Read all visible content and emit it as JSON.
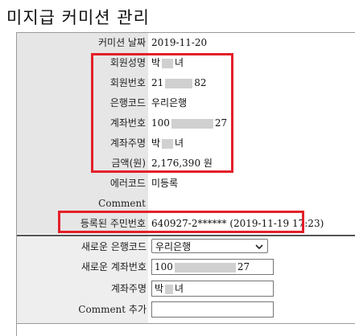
{
  "page": {
    "title": "미지급 커미션 관리"
  },
  "info": {
    "commission_date_label": "커미션 날짜",
    "commission_date_value": "2019-11-20",
    "member_name_label": "회원성명",
    "member_name_prefix": "박",
    "member_name_suffix": "녀",
    "member_no_label": "회원번호",
    "member_no_prefix": "21",
    "member_no_suffix": "82",
    "bank_code_label": "은행코드",
    "bank_code_value": "우리은행",
    "account_no_label": "계좌번호",
    "account_no_prefix": "100",
    "account_no_suffix": "27",
    "account_holder_label": "계좌주명",
    "account_holder_prefix": "박",
    "account_holder_suffix": "녀",
    "amount_label": "금액(원)",
    "amount_value": "2,176,390 원",
    "error_code_label": "에러코드",
    "error_code_value": "미등록",
    "comment_label": "Comment",
    "comment_value": "",
    "registered_id_label": "등록된 주민번호",
    "registered_id_value": "640927-2****** (2019-11-19 17:23)"
  },
  "form": {
    "new_bank_label": "새로운 은행코드",
    "new_bank_selected": "우리은행",
    "new_account_label": "새로운 계좌번호",
    "new_account_prefix": "100",
    "new_account_suffix": "27",
    "holder_label": "계좌주명",
    "holder_prefix": "박",
    "holder_suffix": "녀",
    "comment_add_label": "Comment 추가",
    "comment_add_value": ""
  },
  "colors": {
    "highlight": "#e3202a",
    "label_bg": "#e6e6e6"
  },
  "icons": {
    "select_arrow": "chevron-down-icon"
  }
}
